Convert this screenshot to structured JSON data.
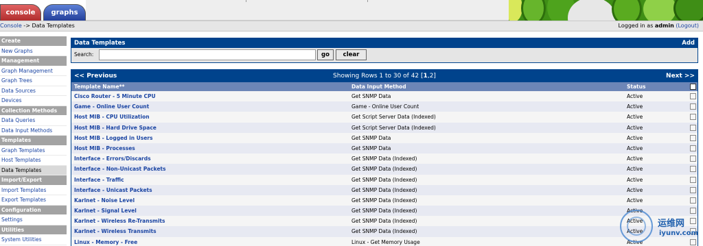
{
  "tabs": [
    {
      "label": "console",
      "color": "#c43c3c"
    },
    {
      "label": "graphs",
      "color": "#2f4fa8"
    }
  ],
  "breadcrumb": {
    "link": "Console",
    "separator": " -> ",
    "current": "Data Templates"
  },
  "login": {
    "prefix": "Logged in as ",
    "user": "admin",
    "logout": "(Logout)"
  },
  "sidebar": {
    "sections": [
      {
        "header": "Create",
        "items": [
          "New Graphs"
        ]
      },
      {
        "header": "Management",
        "items": [
          "Graph Management",
          "Graph Trees",
          "Data Sources",
          "Devices"
        ]
      },
      {
        "header": "Collection Methods",
        "items": [
          "Data Queries",
          "Data Input Methods"
        ]
      },
      {
        "header": "Templates",
        "items": [
          "Graph Templates",
          "Host Templates",
          "Data Templates"
        ]
      },
      {
        "header": "Import/Export",
        "items": [
          "Import Templates",
          "Export Templates"
        ]
      },
      {
        "header": "Configuration",
        "items": [
          "Settings"
        ]
      },
      {
        "header": "Utilities",
        "items": [
          "System Utilities"
        ]
      }
    ],
    "active": "Data Templates"
  },
  "filter_panel": {
    "title": "Data Templates",
    "add_label": "Add",
    "search_label": "Search:",
    "search_value": "",
    "go_label": "go",
    "clear_label": "clear"
  },
  "pager": {
    "prev_label": "<< Previous",
    "next_label": "Next >>",
    "showing_text": "Showing Rows 1 to 30 of 42 ",
    "pages_open": "[",
    "page_current": "1",
    "page_sep": ",",
    "page_other": "2",
    "pages_close": "]"
  },
  "table": {
    "columns": [
      "Template Name**",
      "Data Input Method",
      "Status"
    ],
    "rows": [
      {
        "name": "Cisco Router - 5 Minute CPU",
        "method": "Get SNMP Data",
        "status": "Active"
      },
      {
        "name": "Game - Online User Count",
        "method": "Game - Online User Count",
        "status": "Active"
      },
      {
        "name": "Host MIB - CPU Utilization",
        "method": "Get Script Server Data (Indexed)",
        "status": "Active"
      },
      {
        "name": "Host MIB - Hard Drive Space",
        "method": "Get Script Server Data (Indexed)",
        "status": "Active"
      },
      {
        "name": "Host MIB - Logged in Users",
        "method": "Get SNMP Data",
        "status": "Active"
      },
      {
        "name": "Host MIB - Processes",
        "method": "Get SNMP Data",
        "status": "Active"
      },
      {
        "name": "Interface - Errors/Discards",
        "method": "Get SNMP Data (Indexed)",
        "status": "Active"
      },
      {
        "name": "Interface - Non-Unicast Packets",
        "method": "Get SNMP Data (Indexed)",
        "status": "Active"
      },
      {
        "name": "Interface - Traffic",
        "method": "Get SNMP Data (Indexed)",
        "status": "Active"
      },
      {
        "name": "Interface - Unicast Packets",
        "method": "Get SNMP Data (Indexed)",
        "status": "Active"
      },
      {
        "name": "Karlnet - Noise Level",
        "method": "Get SNMP Data (Indexed)",
        "status": "Active"
      },
      {
        "name": "Karlnet - Signal Level",
        "method": "Get SNMP Data (Indexed)",
        "status": "Active"
      },
      {
        "name": "Karlnet - Wireless Re-Transmits",
        "method": "Get SNMP Data (Indexed)",
        "status": "Active"
      },
      {
        "name": "Karlnet - Wireless Transmits",
        "method": "Get SNMP Data (Indexed)",
        "status": "Active"
      },
      {
        "name": "Linux - Memory - Free",
        "method": "Linux - Get Memory Usage",
        "status": "Active"
      }
    ]
  },
  "watermark": {
    "cn": "运维网",
    "url": "iyunv.com"
  },
  "colors": {
    "header_blue": "#00438c",
    "column_header": "#6d86b7",
    "link": "#1b45a3",
    "sidebar_header": "#a3a3a3"
  }
}
